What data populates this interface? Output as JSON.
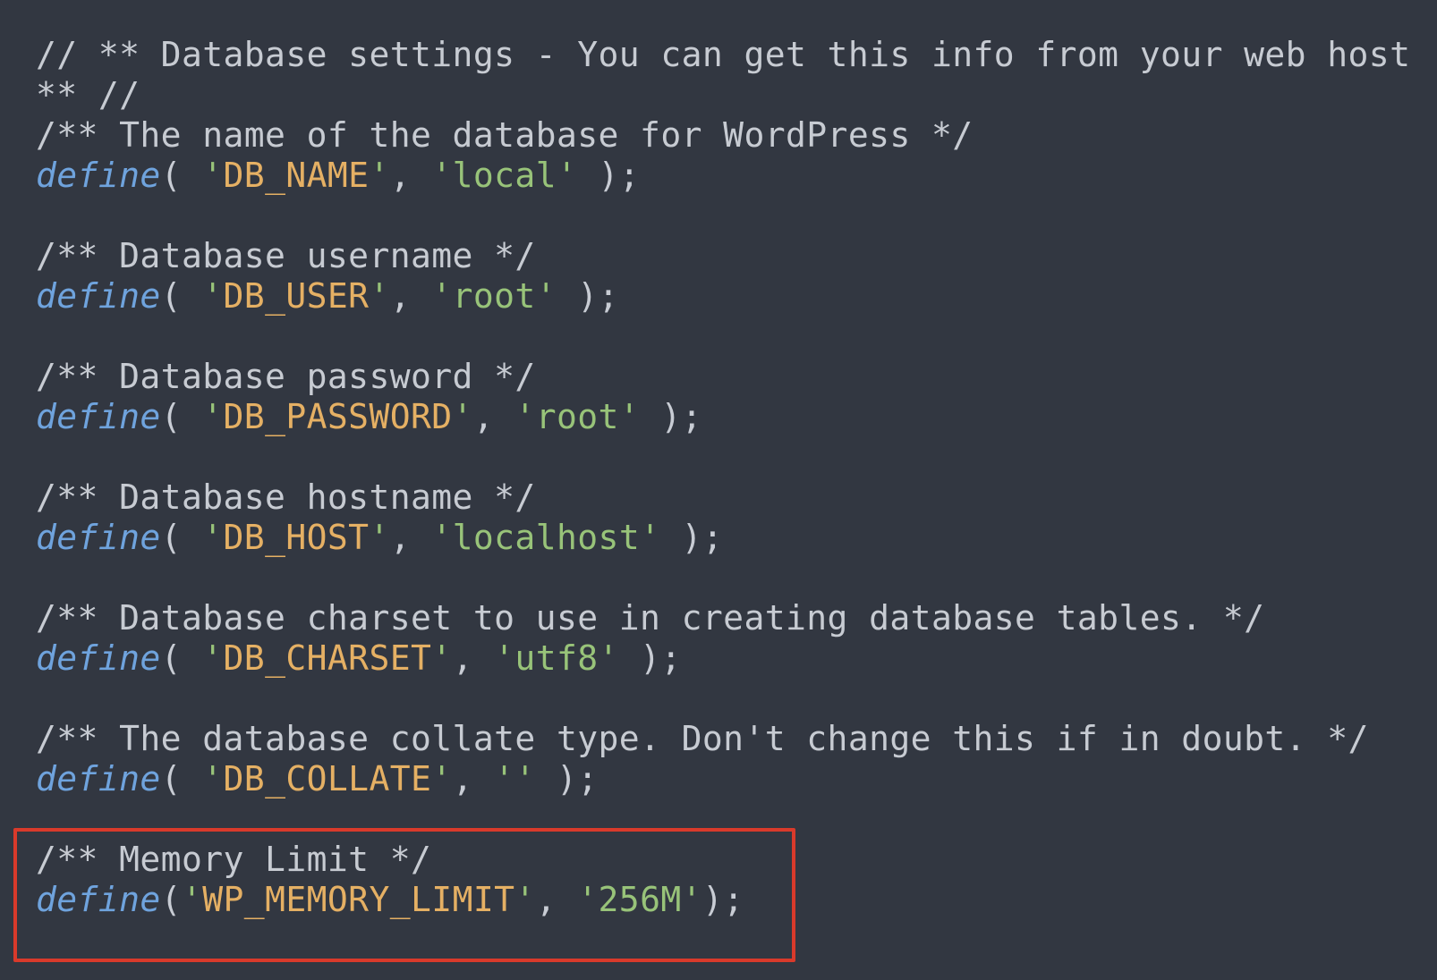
{
  "code": {
    "header_comment_1": "// ** Database settings - You can get this info from your web host",
    "header_comment_2": "** //",
    "blocks": [
      {
        "comment": "/** The name of the database for WordPress */",
        "keyword": "define",
        "open": "( ",
        "const": "DB_NAME",
        "sep": ", ",
        "value": "local",
        "close": " );"
      },
      {
        "comment": "/** Database username */",
        "keyword": "define",
        "open": "( ",
        "const": "DB_USER",
        "sep": ", ",
        "value": "root",
        "close": " );"
      },
      {
        "comment": "/** Database password */",
        "keyword": "define",
        "open": "( ",
        "const": "DB_PASSWORD",
        "sep": ", ",
        "value": "root",
        "close": " );"
      },
      {
        "comment": "/** Database hostname */",
        "keyword": "define",
        "open": "( ",
        "const": "DB_HOST",
        "sep": ", ",
        "value": "localhost",
        "close": " );"
      },
      {
        "comment": "/** Database charset to use in creating database tables. */",
        "keyword": "define",
        "open": "( ",
        "const": "DB_CHARSET",
        "sep": ", ",
        "value": "utf8",
        "close": " );"
      },
      {
        "comment": "/** The database collate type. Don't change this if in doubt. */",
        "keyword": "define",
        "open": "( ",
        "const": "DB_COLLATE",
        "sep": ", ",
        "value": "",
        "close": " );"
      },
      {
        "comment": "/** Memory Limit */",
        "keyword": "define",
        "open": "(",
        "const": "WP_MEMORY_LIMIT",
        "sep": ", ",
        "value": "256M",
        "close": ");"
      }
    ],
    "quote": "'"
  },
  "colors": {
    "background": "#323741",
    "comment": "#c7cbd2",
    "keyword": "#6fa3dd",
    "constant": "#e5b064",
    "string": "#98c379",
    "highlight_border": "#d93a2b"
  }
}
